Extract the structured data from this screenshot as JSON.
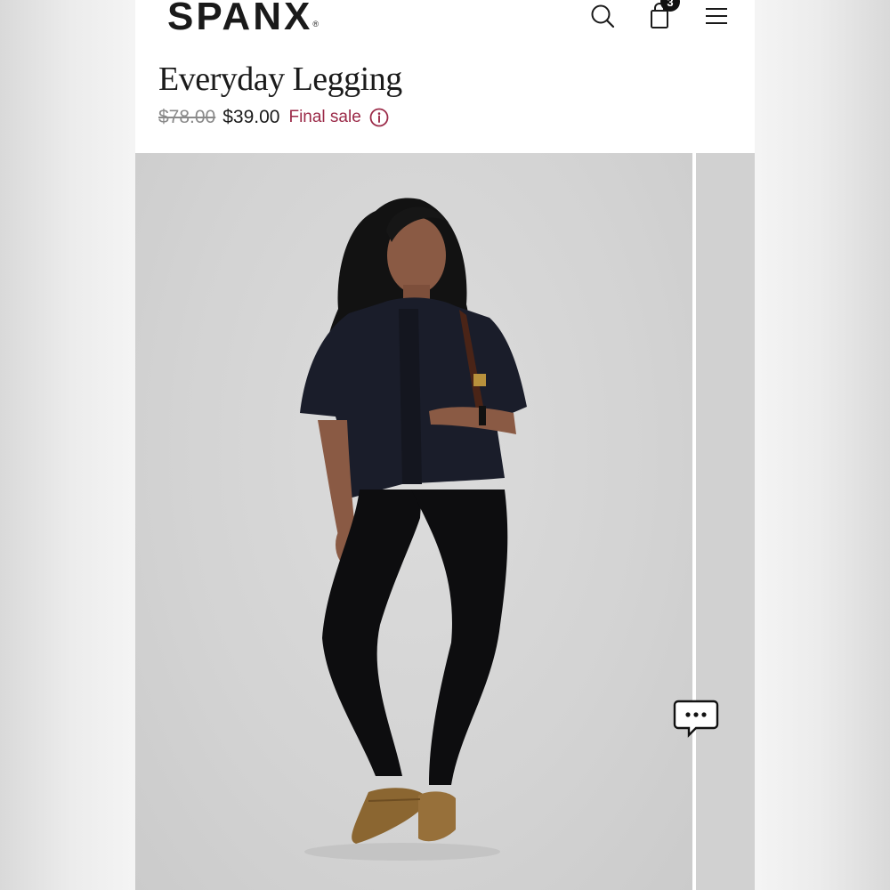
{
  "header": {
    "brand": "SPANX",
    "brand_mark": "®",
    "cart_count": "3",
    "icons": {
      "search": "search-icon",
      "cart": "shopping-bag-icon",
      "menu": "hamburger-menu-icon"
    }
  },
  "product": {
    "title": "Everyday Legging",
    "original_price": "$78.00",
    "sale_price": "$39.00",
    "sale_label": "Final sale",
    "sale_color": "#9b2a48",
    "info_icon": "info-icon"
  },
  "gallery": {
    "current_image": "model-photo",
    "has_next_slide": true
  },
  "chat": {
    "icon": "chat-bubble-icon"
  }
}
